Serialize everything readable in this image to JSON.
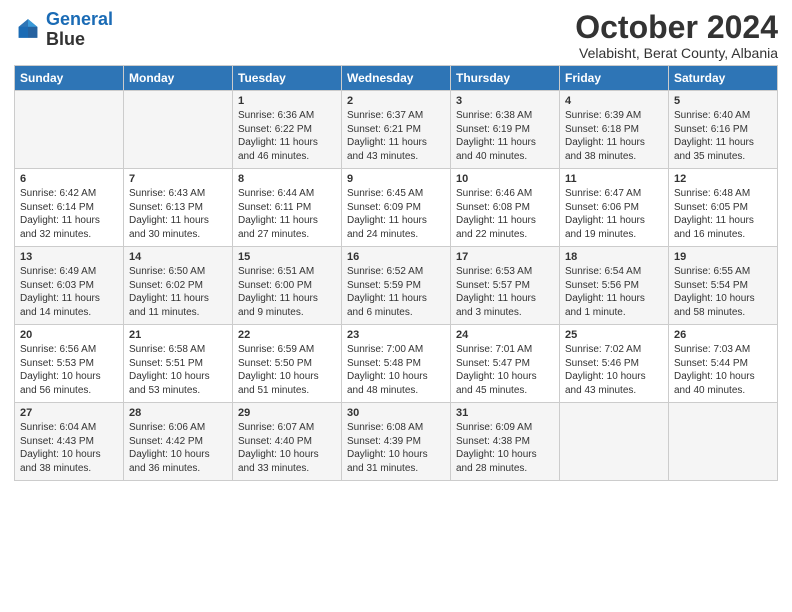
{
  "header": {
    "logo_line1": "General",
    "logo_line2": "Blue",
    "month": "October 2024",
    "location": "Velabisht, Berat County, Albania"
  },
  "days_of_week": [
    "Sunday",
    "Monday",
    "Tuesday",
    "Wednesday",
    "Thursday",
    "Friday",
    "Saturday"
  ],
  "weeks": [
    [
      {
        "day": "",
        "info": ""
      },
      {
        "day": "",
        "info": ""
      },
      {
        "day": "1",
        "info": "Sunrise: 6:36 AM\nSunset: 6:22 PM\nDaylight: 11 hours and 46 minutes."
      },
      {
        "day": "2",
        "info": "Sunrise: 6:37 AM\nSunset: 6:21 PM\nDaylight: 11 hours and 43 minutes."
      },
      {
        "day": "3",
        "info": "Sunrise: 6:38 AM\nSunset: 6:19 PM\nDaylight: 11 hours and 40 minutes."
      },
      {
        "day": "4",
        "info": "Sunrise: 6:39 AM\nSunset: 6:18 PM\nDaylight: 11 hours and 38 minutes."
      },
      {
        "day": "5",
        "info": "Sunrise: 6:40 AM\nSunset: 6:16 PM\nDaylight: 11 hours and 35 minutes."
      }
    ],
    [
      {
        "day": "6",
        "info": "Sunrise: 6:42 AM\nSunset: 6:14 PM\nDaylight: 11 hours and 32 minutes."
      },
      {
        "day": "7",
        "info": "Sunrise: 6:43 AM\nSunset: 6:13 PM\nDaylight: 11 hours and 30 minutes."
      },
      {
        "day": "8",
        "info": "Sunrise: 6:44 AM\nSunset: 6:11 PM\nDaylight: 11 hours and 27 minutes."
      },
      {
        "day": "9",
        "info": "Sunrise: 6:45 AM\nSunset: 6:09 PM\nDaylight: 11 hours and 24 minutes."
      },
      {
        "day": "10",
        "info": "Sunrise: 6:46 AM\nSunset: 6:08 PM\nDaylight: 11 hours and 22 minutes."
      },
      {
        "day": "11",
        "info": "Sunrise: 6:47 AM\nSunset: 6:06 PM\nDaylight: 11 hours and 19 minutes."
      },
      {
        "day": "12",
        "info": "Sunrise: 6:48 AM\nSunset: 6:05 PM\nDaylight: 11 hours and 16 minutes."
      }
    ],
    [
      {
        "day": "13",
        "info": "Sunrise: 6:49 AM\nSunset: 6:03 PM\nDaylight: 11 hours and 14 minutes."
      },
      {
        "day": "14",
        "info": "Sunrise: 6:50 AM\nSunset: 6:02 PM\nDaylight: 11 hours and 11 minutes."
      },
      {
        "day": "15",
        "info": "Sunrise: 6:51 AM\nSunset: 6:00 PM\nDaylight: 11 hours and 9 minutes."
      },
      {
        "day": "16",
        "info": "Sunrise: 6:52 AM\nSunset: 5:59 PM\nDaylight: 11 hours and 6 minutes."
      },
      {
        "day": "17",
        "info": "Sunrise: 6:53 AM\nSunset: 5:57 PM\nDaylight: 11 hours and 3 minutes."
      },
      {
        "day": "18",
        "info": "Sunrise: 6:54 AM\nSunset: 5:56 PM\nDaylight: 11 hours and 1 minute."
      },
      {
        "day": "19",
        "info": "Sunrise: 6:55 AM\nSunset: 5:54 PM\nDaylight: 10 hours and 58 minutes."
      }
    ],
    [
      {
        "day": "20",
        "info": "Sunrise: 6:56 AM\nSunset: 5:53 PM\nDaylight: 10 hours and 56 minutes."
      },
      {
        "day": "21",
        "info": "Sunrise: 6:58 AM\nSunset: 5:51 PM\nDaylight: 10 hours and 53 minutes."
      },
      {
        "day": "22",
        "info": "Sunrise: 6:59 AM\nSunset: 5:50 PM\nDaylight: 10 hours and 51 minutes."
      },
      {
        "day": "23",
        "info": "Sunrise: 7:00 AM\nSunset: 5:48 PM\nDaylight: 10 hours and 48 minutes."
      },
      {
        "day": "24",
        "info": "Sunrise: 7:01 AM\nSunset: 5:47 PM\nDaylight: 10 hours and 45 minutes."
      },
      {
        "day": "25",
        "info": "Sunrise: 7:02 AM\nSunset: 5:46 PM\nDaylight: 10 hours and 43 minutes."
      },
      {
        "day": "26",
        "info": "Sunrise: 7:03 AM\nSunset: 5:44 PM\nDaylight: 10 hours and 40 minutes."
      }
    ],
    [
      {
        "day": "27",
        "info": "Sunrise: 6:04 AM\nSunset: 4:43 PM\nDaylight: 10 hours and 38 minutes."
      },
      {
        "day": "28",
        "info": "Sunrise: 6:06 AM\nSunset: 4:42 PM\nDaylight: 10 hours and 36 minutes."
      },
      {
        "day": "29",
        "info": "Sunrise: 6:07 AM\nSunset: 4:40 PM\nDaylight: 10 hours and 33 minutes."
      },
      {
        "day": "30",
        "info": "Sunrise: 6:08 AM\nSunset: 4:39 PM\nDaylight: 10 hours and 31 minutes."
      },
      {
        "day": "31",
        "info": "Sunrise: 6:09 AM\nSunset: 4:38 PM\nDaylight: 10 hours and 28 minutes."
      },
      {
        "day": "",
        "info": ""
      },
      {
        "day": "",
        "info": ""
      }
    ]
  ]
}
